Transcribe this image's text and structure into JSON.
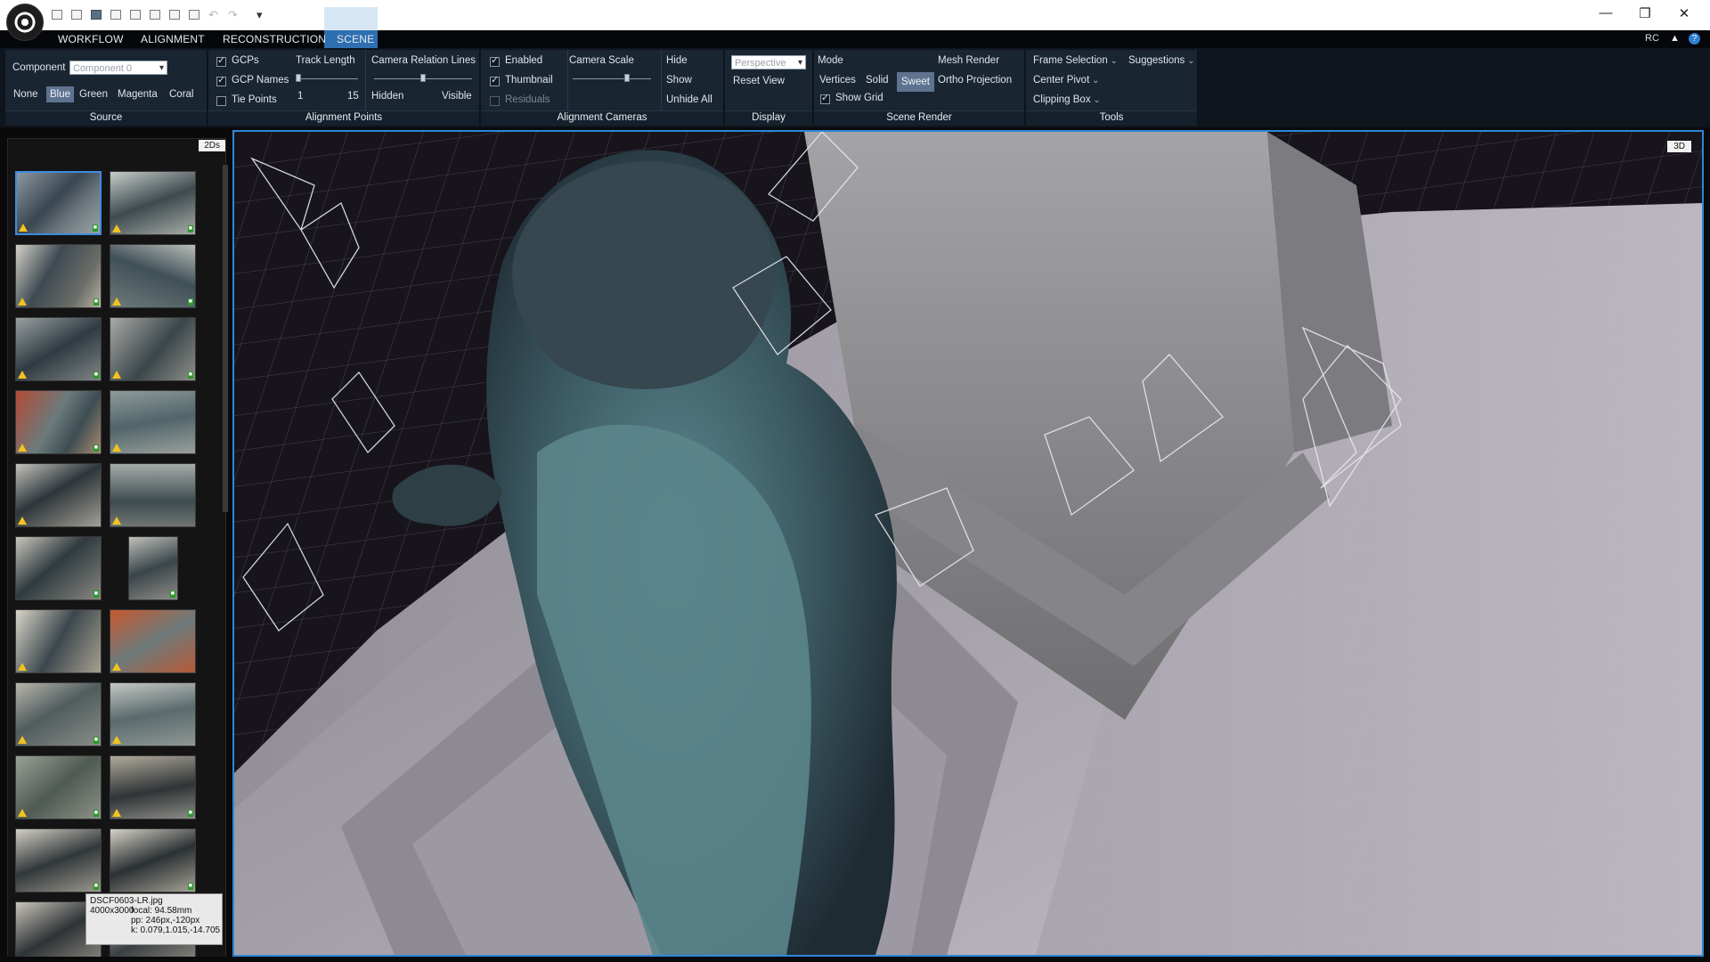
{
  "menu": {
    "items": [
      "WORKFLOW",
      "ALIGNMENT",
      "RECONSTRUCTION",
      "SCENE"
    ],
    "active": "SCENE",
    "right_label": "RC"
  },
  "ribbon": {
    "source": {
      "component_label": "Component",
      "component_value": "Component 0",
      "colors": [
        "None",
        "Blue",
        "Green",
        "Magenta",
        "Coral"
      ],
      "active_color": "Blue",
      "title": "Source"
    },
    "alignment_points": {
      "gcps": "GCPs",
      "gcp_names": "GCP Names",
      "tie_points": "Tie Points",
      "track_length": "Track Length",
      "track_min": "1",
      "track_max": "15",
      "camera_relation_lines": "Camera Relation Lines",
      "hidden": "Hidden",
      "visible": "Visible",
      "title": "Alignment Points"
    },
    "alignment_cameras": {
      "enabled": "Enabled",
      "thumbnail": "Thumbnail",
      "residuals": "Residuals",
      "camera_scale": "Camera Scale",
      "hide": "Hide",
      "show": "Show",
      "unhide_all": "Unhide All",
      "title": "Alignment Cameras"
    },
    "display": {
      "projection_value": "Perspective",
      "reset_view": "Reset View",
      "title": "Display"
    },
    "scene_render": {
      "mode": "Mode",
      "mesh_render": "Mesh Render",
      "vertices": "Vertices",
      "solid": "Solid",
      "sweet": "Sweet",
      "ortho_projection": "Ortho Projection",
      "show_grid": "Show Grid",
      "title": "Scene Render"
    },
    "tools": {
      "frame_selection": "Frame Selection",
      "suggestions": "Suggestions",
      "center_pivot": "Center Pivot",
      "clipping_box": "Clipping Box",
      "title": "Tools"
    }
  },
  "panel2d": {
    "tag": "2Ds",
    "tooltip": {
      "filename": "DSCF0603-LR.jpg",
      "resolution": "4000x3000",
      "focal": "focal: 94.58mm",
      "pp": "pp: 246px,-120px",
      "k": "k: 0.079,1.015,-14.705"
    }
  },
  "view3d": {
    "tag": "3D"
  },
  "colors": {
    "accent": "#2f86d6",
    "menubar": "#05070a",
    "ribbon": "#1a2532",
    "warning": "#f2c41d"
  }
}
